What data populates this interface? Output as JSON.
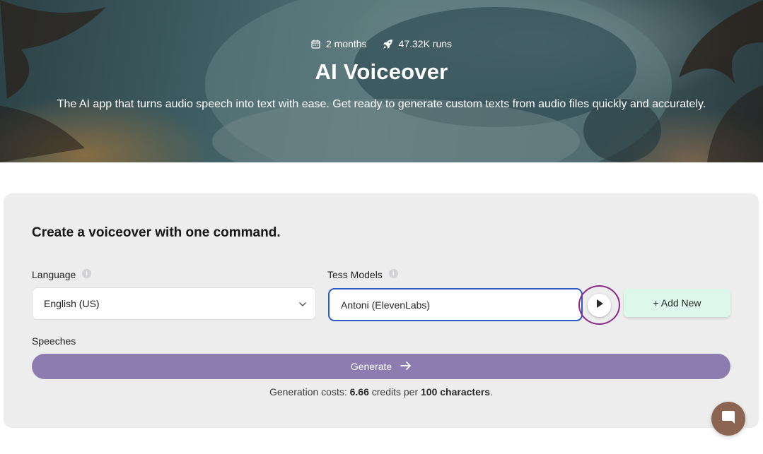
{
  "hero": {
    "age": "2 months",
    "runs": "47.32K runs",
    "title": "AI Voiceover",
    "description": "The AI app that turns audio speech into text with ease. Get ready to generate custom texts from audio files quickly and accurately."
  },
  "form": {
    "heading": "Create a voiceover with one command.",
    "language_label": "Language",
    "language_value": "English (US)",
    "models_label": "Tess Models",
    "model_value": "Antoni (ElevenLabs)",
    "add_new_label": "+ Add New",
    "speeches_label": "Speeches",
    "generate_label": "Generate",
    "cost": {
      "prefix": "Generation costs: ",
      "credits": "6.66",
      "middle": " credits per ",
      "unit": "100 characters",
      "suffix": "."
    }
  },
  "icons": {
    "age": "calendar-icon",
    "runs": "rocket-icon",
    "info": "info-icon",
    "dropdown": "chevron-down-icon",
    "play": "play-icon",
    "generate": "arrow-right-icon",
    "chat": "chat-icon"
  },
  "colors": {
    "model_focus_border": "#2e59c6",
    "play_ring": "#8c2a88",
    "add_button_bg": "#def7ec",
    "generate_button_bg": "#8c7cb0",
    "chat_button_bg": "#8b6552",
    "card_bg": "#ededee"
  }
}
